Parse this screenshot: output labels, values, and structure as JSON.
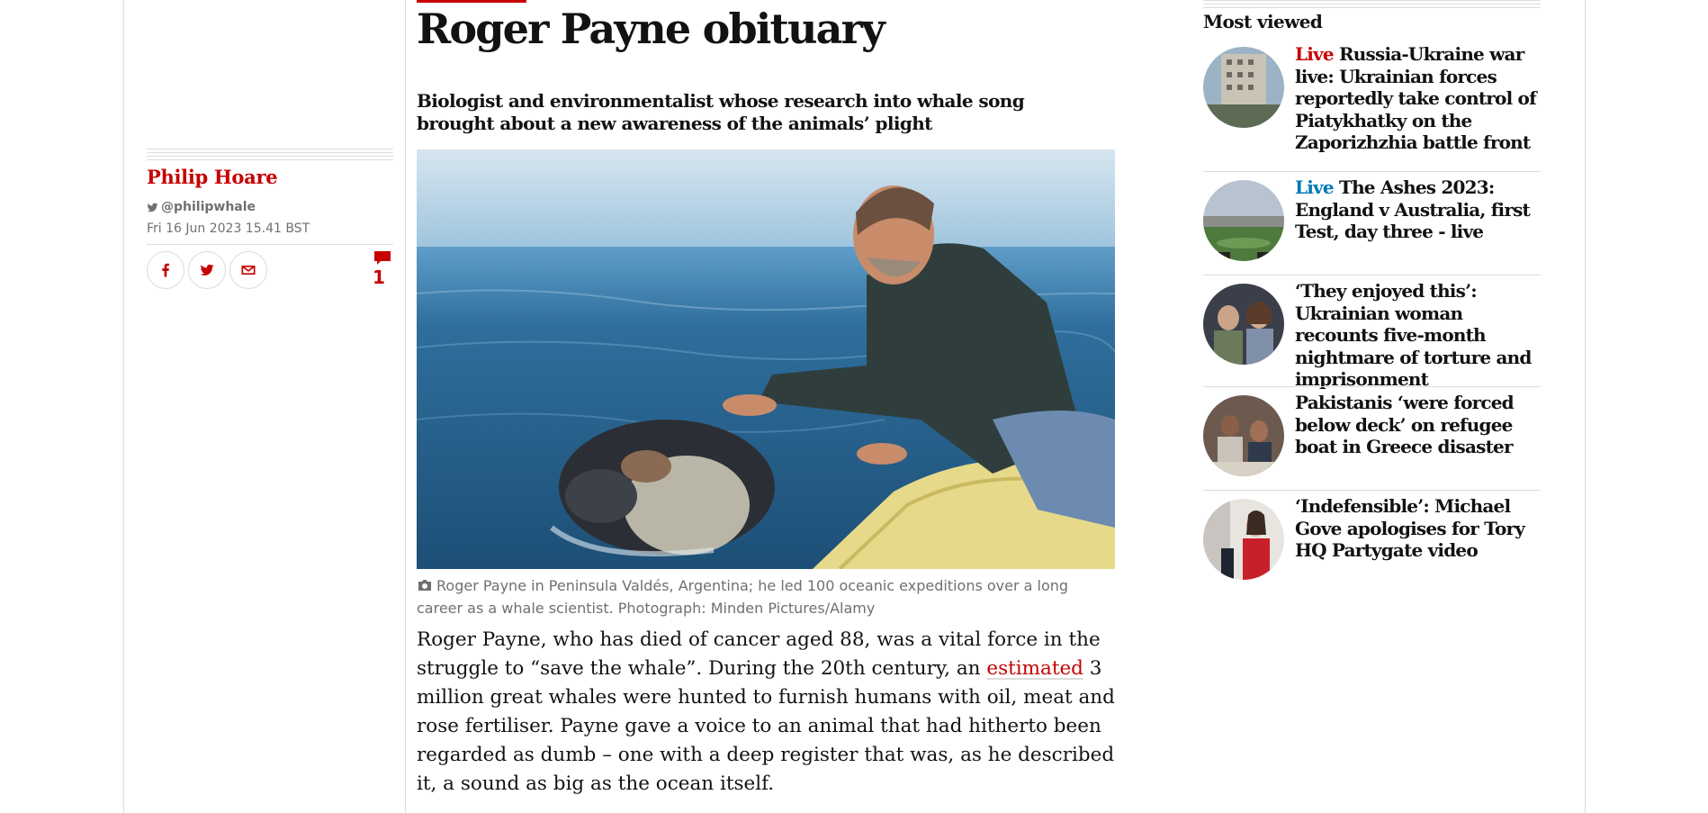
{
  "author": {
    "name": "Philip Hoare",
    "twitter": "@philipwhale",
    "date": "Fri 16 Jun 2023 15.41 BST"
  },
  "share": {
    "facebook_icon": "facebook-icon",
    "twitter_icon": "twitter-icon",
    "email_icon": "email-icon"
  },
  "comments": {
    "count": "1"
  },
  "article": {
    "headline": "Roger Payne obituary",
    "standfirst": "Biologist and environmentalist whose research into whale song brought about a new awareness of the animals’ plight",
    "caption": "Roger Payne in Peninsula Valdés, Argentina; he led 100 oceanic expeditions over a long career as a whale scientist. Photograph: Minden Pictures/Alamy",
    "body_before_link": "Roger Payne, who has died of cancer aged 88, was a vital force in the struggle to “save the whale”. During the 20th century, an ",
    "body_link": "estimated",
    "body_after_link": " 3 million great whales were hunted to furnish humans with oil, meat and rose fertiliser. Payne gave a voice to an animal that had hitherto been regarded as dumb – one with a deep register that was, as he described it, a sound as big as the ocean itself."
  },
  "most_viewed": {
    "title": "Most viewed",
    "items": [
      {
        "kicker": "Live",
        "headline": "Russia-Ukraine war live: Ukrainian forces reportedly take control of Piatykhatky on the Zaporizhzhia battle front"
      },
      {
        "kicker": "Live",
        "headline": "The Ashes 2023: England v Australia, first Test, day three - live"
      },
      {
        "kicker": "",
        "headline": "‘They enjoyed this’: Ukrainian woman recounts five-month nightmare of torture and imprisonment"
      },
      {
        "kicker": "",
        "headline": "Pakistanis ‘were forced below deck’ on refugee boat in Greece disaster"
      },
      {
        "kicker": "",
        "headline": "‘Indefensible’: Michael Gove apologises for Tory HQ Partygate video"
      }
    ]
  },
  "colors": {
    "accent": "#c70000",
    "live_blue": "#0077b6",
    "text": "#121212",
    "secondary": "#707070",
    "rule": "#dcdcdc"
  }
}
